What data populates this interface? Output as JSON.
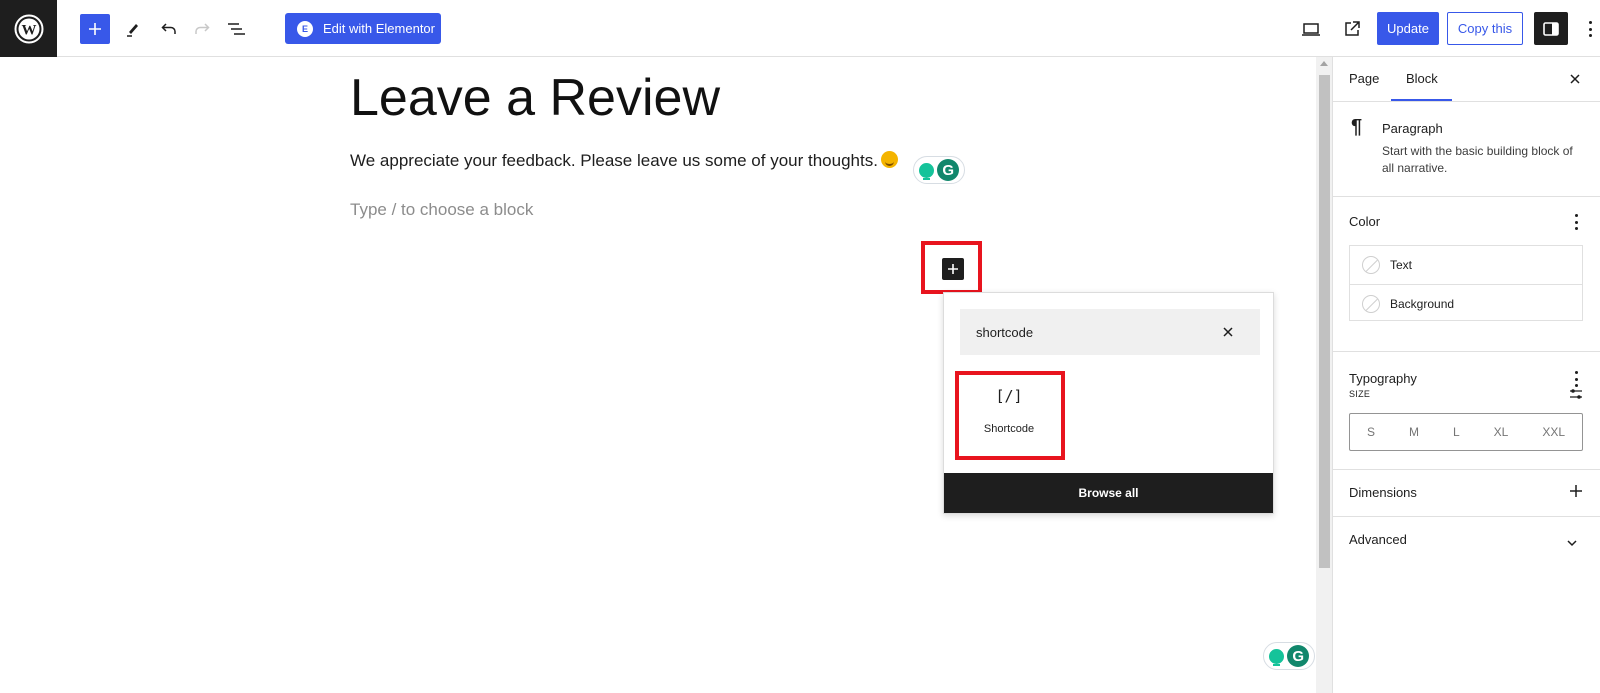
{
  "topbar": {
    "logo": "wordpress-logo",
    "inserter_icon": "plus-icon",
    "tools": [
      {
        "name": "pencil-icon",
        "enabled": true
      },
      {
        "name": "undo-icon",
        "enabled": true
      },
      {
        "name": "redo-icon",
        "enabled": false
      },
      {
        "name": "list-view-icon",
        "enabled": true
      }
    ],
    "elementor_label": "Edit with Elementor",
    "elementor_badge": "E",
    "update_label": "Update",
    "copy_label": "Copy this",
    "colors": {
      "accent": "#3858e9",
      "dark": "#1e1e1e"
    }
  },
  "editor": {
    "title": "Leave a Review",
    "paragraph": "We appreciate your feedback. Please leave us some of your thoughts.",
    "paragraph_emoji": "smiling-face-emoji",
    "placeholder": "Type / to choose a block",
    "grammarly_letter": "G"
  },
  "inserter": {
    "search_value": "shortcode",
    "results": [
      {
        "label": "Shortcode",
        "icon": "[/]"
      }
    ],
    "browse_all_label": "Browse all",
    "highlight_color": "#e8141e"
  },
  "sidebar": {
    "tabs": [
      {
        "label": "Page",
        "active": false
      },
      {
        "label": "Block",
        "active": true
      }
    ],
    "block": {
      "name": "Paragraph",
      "description": "Start with the basic building block of all narrative."
    },
    "color": {
      "title": "Color",
      "items": [
        "Text",
        "Background"
      ]
    },
    "typography": {
      "title": "Typography",
      "size_label": "SIZE",
      "sizes": [
        "S",
        "M",
        "L",
        "XL",
        "XXL"
      ]
    },
    "dimensions": {
      "title": "Dimensions"
    },
    "advanced": {
      "title": "Advanced"
    }
  }
}
